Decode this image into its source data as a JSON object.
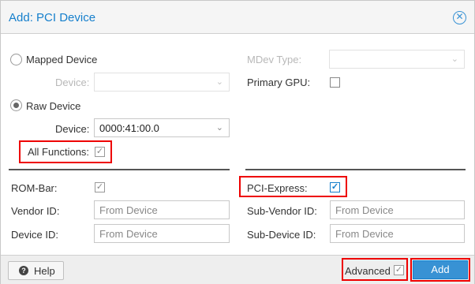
{
  "dialog": {
    "title": "Add: PCI Device"
  },
  "mapped_device": {
    "label": "Mapped Device",
    "device_label": "Device:",
    "selected": false
  },
  "raw_device": {
    "label": "Raw Device",
    "device_label": "Device:",
    "device_value": "0000:41:00.0",
    "selected": true
  },
  "all_functions": {
    "label": "All Functions:",
    "checked": true
  },
  "mdev_type": {
    "label": "MDev Type:"
  },
  "primary_gpu": {
    "label": "Primary GPU:",
    "checked": false
  },
  "advanced": {
    "rom_bar": {
      "label": "ROM-Bar:",
      "checked": true
    },
    "pci_express": {
      "label": "PCI-Express:",
      "checked": true
    },
    "vendor_id": {
      "label": "Vendor ID:",
      "placeholder": "From Device"
    },
    "sub_vendor_id": {
      "label": "Sub-Vendor ID:",
      "placeholder": "From Device"
    },
    "device_id": {
      "label": "Device ID:",
      "placeholder": "From Device"
    },
    "sub_device_id": {
      "label": "Sub-Device ID:",
      "placeholder": "From Device"
    }
  },
  "footer": {
    "help_label": "Help",
    "advanced_label": "Advanced",
    "advanced_checked": true,
    "add_label": "Add"
  },
  "icons": {
    "close": "close-circle-icon",
    "help": "question-circle-icon",
    "check": "✓",
    "chevron": "⌄"
  },
  "colors": {
    "accent": "#157fcc",
    "button": "#3892d4",
    "highlight_box": "#ee0000"
  }
}
